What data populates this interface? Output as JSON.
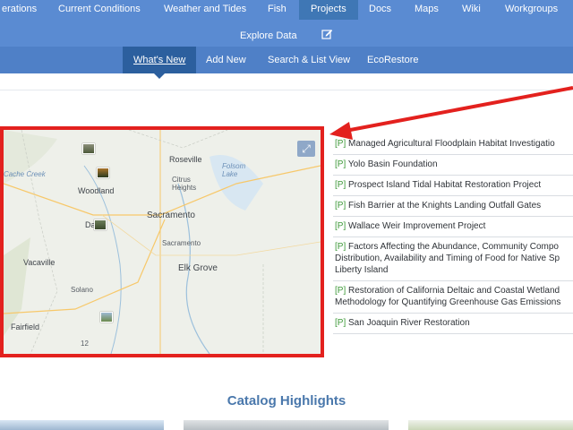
{
  "nav": {
    "items": [
      {
        "label": "erations",
        "active": false
      },
      {
        "label": "Current Conditions",
        "active": false
      },
      {
        "label": "Weather and Tides",
        "active": false
      },
      {
        "label": "Fish",
        "active": false
      },
      {
        "label": "Projects",
        "active": true
      },
      {
        "label": "Docs",
        "active": false
      },
      {
        "label": "Maps",
        "active": false
      },
      {
        "label": "Wiki",
        "active": false
      },
      {
        "label": "Workgroups",
        "active": false
      }
    ],
    "explore_data": "Explore Data",
    "edit_icon": "edit-icon"
  },
  "subnav": {
    "items": [
      {
        "label": "What's New",
        "active": true
      },
      {
        "label": "Add New",
        "active": false
      },
      {
        "label": "Search & List View",
        "active": false
      },
      {
        "label": "EcoRestore",
        "active": false
      }
    ]
  },
  "map": {
    "expand_icon": "expand-icon",
    "labels": {
      "roseville": "Roseville",
      "folsom_lake": "Folsom\nLake",
      "citrus_heights": "Citrus\nHeights",
      "cache_creek": "Cache Creek",
      "woodland": "Woodland",
      "davis": "Da",
      "sacramento": "Sacramento",
      "sacramento_small": "Sacramento",
      "elk_grove": "Elk Grove",
      "vacaville": "Vacaville",
      "solano": "Solano",
      "fairfield": "Fairfield",
      "route_12": "12"
    }
  },
  "projects": [
    {
      "tag": "[P]",
      "title": "Managed Agricultural Floodplain Habitat Investigatio"
    },
    {
      "tag": "[P]",
      "title": "Yolo Basin Foundation"
    },
    {
      "tag": "[P]",
      "title": "Prospect Island Tidal Habitat Restoration Project"
    },
    {
      "tag": "[P]",
      "title": "Fish Barrier at the Knights Landing Outfall Gates"
    },
    {
      "tag": "[P]",
      "title": "Wallace Weir Improvement Project"
    },
    {
      "tag": "[P]",
      "title": "Factors Affecting the Abundance, Community Compo",
      "extra": [
        "Distribution, Availability and Timing of Food for Native Sp",
        "Liberty Island"
      ]
    },
    {
      "tag": "[P]",
      "title": "Restoration of California Deltaic and Coastal Wetland",
      "extra": [
        "Methodology for Quantifying Greenhouse Gas Emissions"
      ]
    },
    {
      "tag": "[P]",
      "title": "San Joaquin River Restoration"
    }
  ],
  "catalog": {
    "title": "Catalog Highlights"
  },
  "colors": {
    "nav": "#5a8bd2",
    "nav_active": "#3f77b5",
    "subnav": "#4f80c7",
    "highlight": "#e3211e",
    "tag": "#3f9a3a",
    "catalog_title": "#4a78ac"
  }
}
